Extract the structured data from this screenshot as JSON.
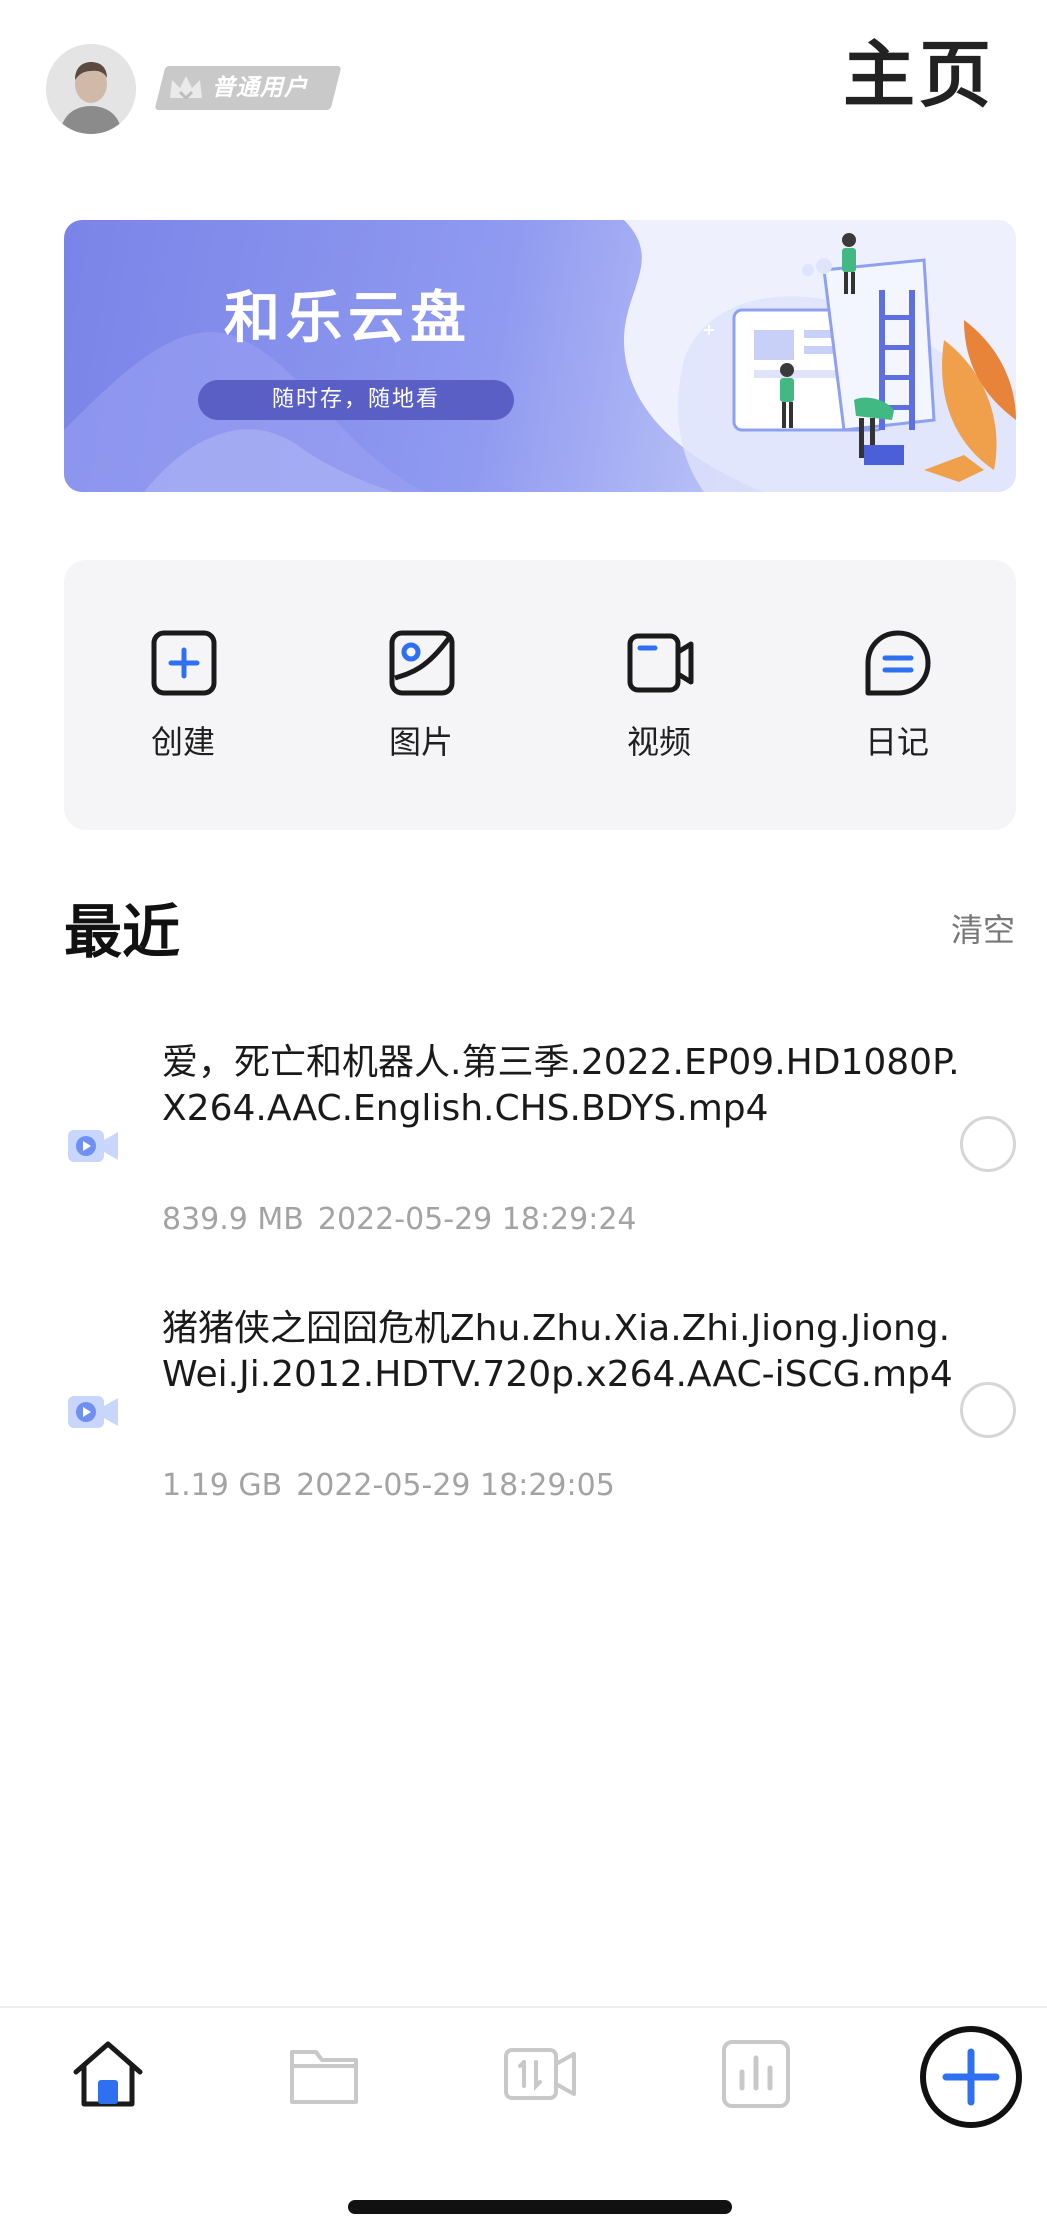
{
  "header": {
    "user_level": "普通用户",
    "page_title": "主页"
  },
  "banner": {
    "title": "和乐云盘",
    "subtitle": "随时存，随地看"
  },
  "actions": [
    {
      "label": "创建",
      "icon": "plus-square-icon"
    },
    {
      "label": "图片",
      "icon": "image-icon"
    },
    {
      "label": "视频",
      "icon": "video-camera-icon"
    },
    {
      "label": "日记",
      "icon": "diary-chat-icon"
    }
  ],
  "recent": {
    "title": "最近",
    "clear_label": "清空",
    "files": [
      {
        "name": "爱，死亡和机器人.第三季.2022.EP09.HD1080P.X264.AAC.English.CHS.BDYS.mp4",
        "size": "839.9 MB",
        "date": "2022-05-29 18:29:24",
        "icon": "video-file-icon"
      },
      {
        "name": "猪猪侠之囧囧危机Zhu.Zhu.Xia.Zhi.Jiong.Jiong.Wei.Ji.2012.HDTV.720p.x264.AAC-iSCG.mp4",
        "size": "1.19 GB",
        "date": "2022-05-29 18:29:05",
        "icon": "video-file-icon"
      }
    ]
  },
  "tabbar": {
    "items": [
      "home-icon",
      "folder-icon",
      "transfer-icon",
      "stats-icon"
    ],
    "fab_icon": "plus-circle-icon"
  },
  "colors": {
    "accent": "#2f6ff2",
    "banner": "#7a84e8",
    "text_secondary": "#a3a3a3"
  }
}
